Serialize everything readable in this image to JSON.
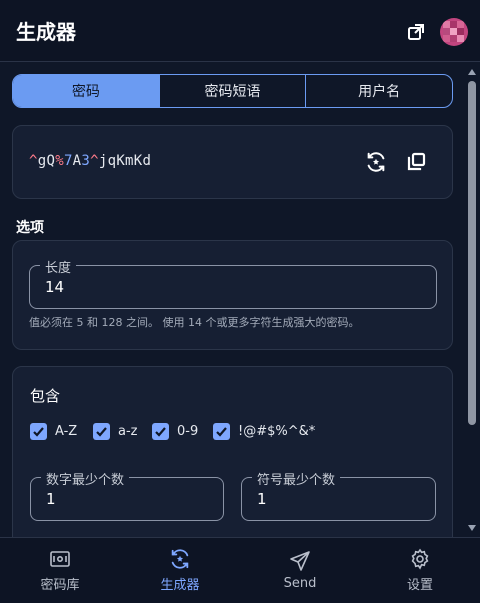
{
  "header": {
    "title": "生成器",
    "popout_icon": "popout-icon",
    "avatar_icon": "avatar"
  },
  "tabs": [
    {
      "label": "密码",
      "active": true
    },
    {
      "label": "密码短语",
      "active": false
    },
    {
      "label": "用户名",
      "active": false
    }
  ],
  "password": {
    "value": "^gQ%7A3^jqKmKd",
    "segments": [
      {
        "text": "^",
        "kind": "sym"
      },
      {
        "text": "gQ",
        "kind": "char"
      },
      {
        "text": "%",
        "kind": "sym"
      },
      {
        "text": "7",
        "kind": "num"
      },
      {
        "text": "A",
        "kind": "char"
      },
      {
        "text": "3",
        "kind": "num"
      },
      {
        "text": "^",
        "kind": "sym"
      },
      {
        "text": "jqKmKd",
        "kind": "char"
      }
    ],
    "regenerate_icon": "regenerate-icon",
    "copy_icon": "copy-icon"
  },
  "options": {
    "section_label": "选项",
    "length_label": "长度",
    "length_value": "14",
    "length_hint": "值必须在 5 和 128 之间。 使用 14 个或更多字符生成强大的密码。"
  },
  "include": {
    "title": "包含",
    "checkboxes": [
      {
        "label": "A-Z",
        "checked": true
      },
      {
        "label": "a-z",
        "checked": true
      },
      {
        "label": "0-9",
        "checked": true
      },
      {
        "label": "!@#$%^&*",
        "checked": true
      }
    ],
    "min_numbers_label": "数字最少个数",
    "min_numbers_value": "1",
    "min_special_label": "符号最少个数",
    "min_special_value": "1"
  },
  "nav": [
    {
      "label": "密码库",
      "icon": "vault-icon",
      "active": false
    },
    {
      "label": "生成器",
      "icon": "generator-icon",
      "active": true
    },
    {
      "label": "Send",
      "icon": "send-icon",
      "active": false
    },
    {
      "label": "设置",
      "icon": "settings-icon",
      "active": false
    }
  ],
  "colors": {
    "background": "#0f1728",
    "card": "#161f33",
    "accent": "#7ea7ff",
    "symbol": "#ff7b8a"
  }
}
